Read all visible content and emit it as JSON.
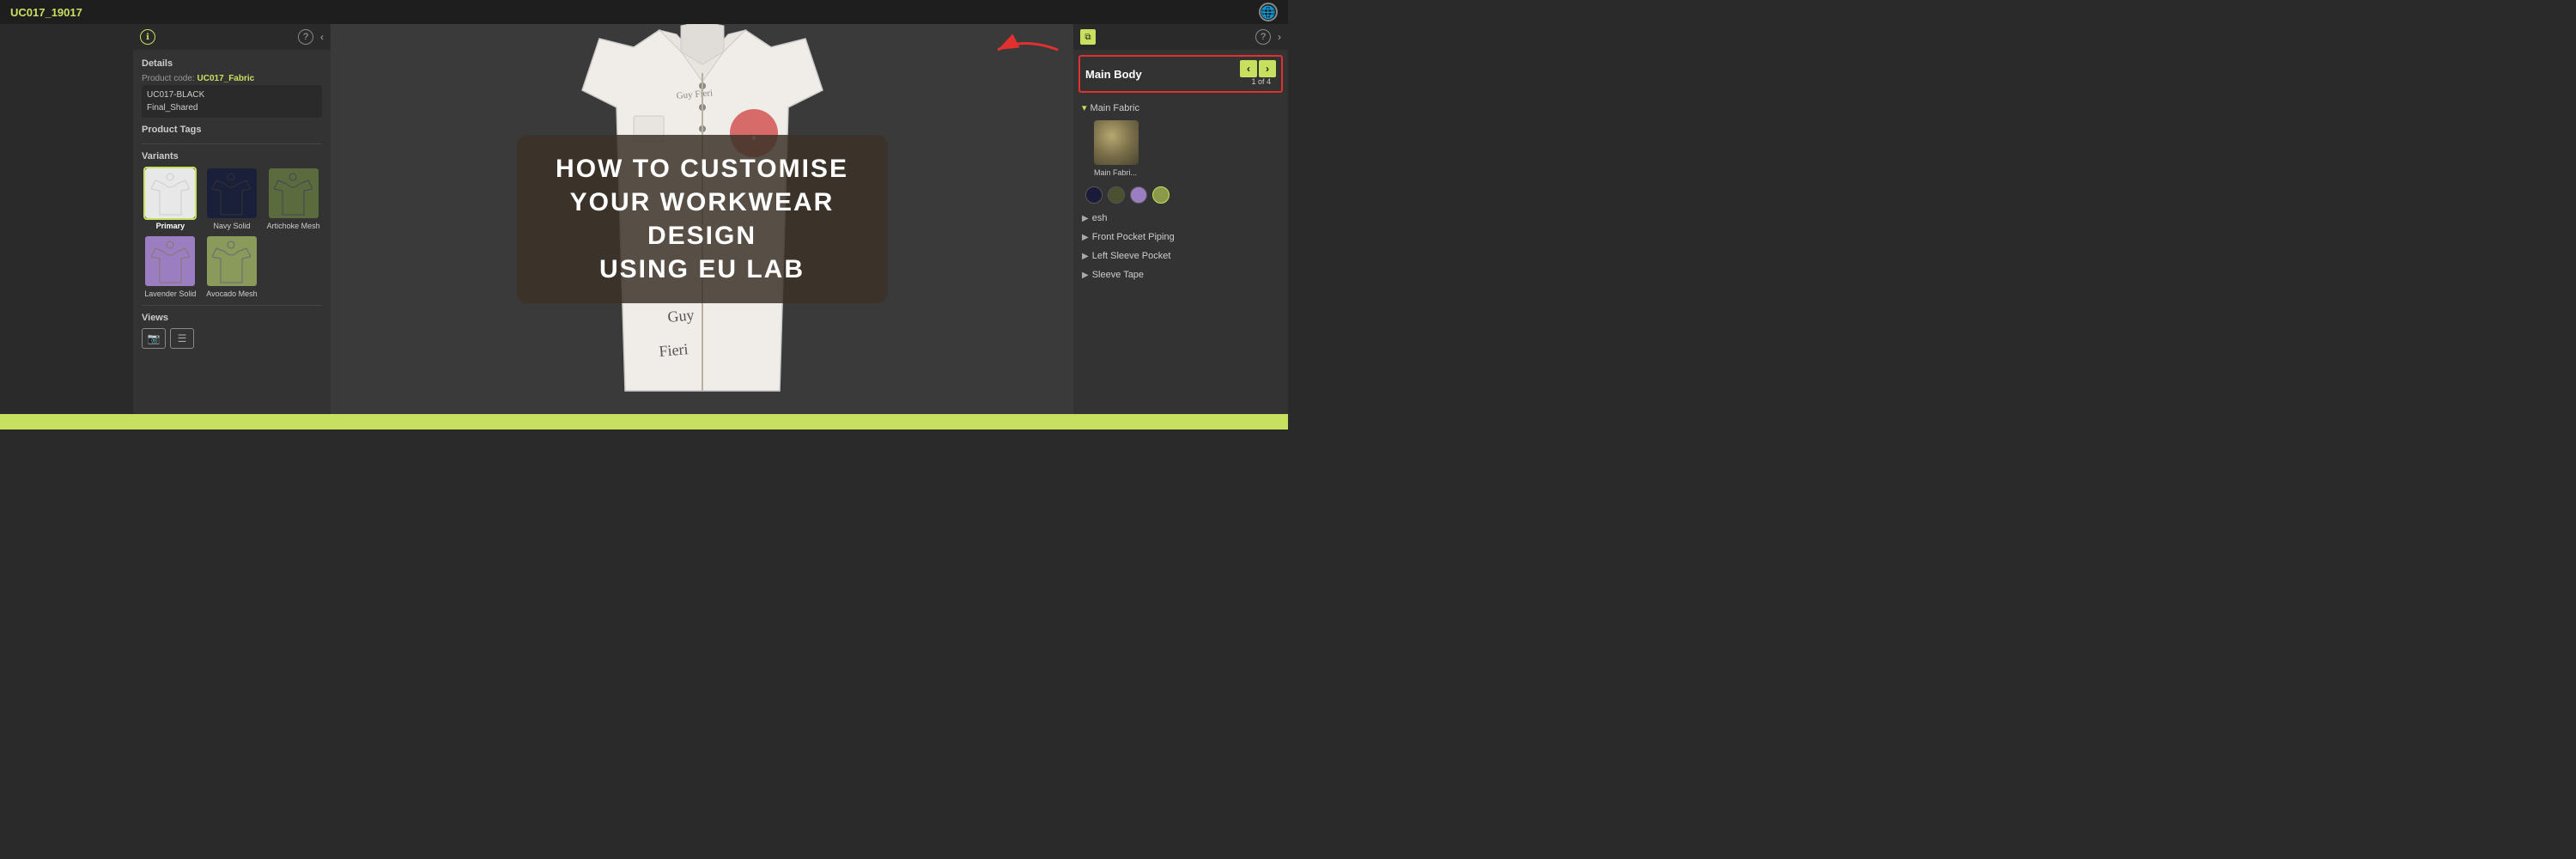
{
  "topbar": {
    "product_id": "UC017_19017",
    "globe_icon": "🌐"
  },
  "left_panel": {
    "details_label": "Details",
    "product_code_label": "Product code:",
    "product_code_value": "UC017_Fabric",
    "variant_names": [
      "UC017-BLACK",
      "Final_Shared"
    ],
    "product_tags_label": "Product Tags",
    "variants_label": "Variants",
    "variants": [
      {
        "name": "Primary",
        "color": "white",
        "selected": true
      },
      {
        "name": "Navy Solid",
        "color": "navy",
        "selected": false
      },
      {
        "name": "Artichoke Mesh",
        "color": "artichoke",
        "selected": false
      },
      {
        "name": "Lavender Solid",
        "color": "lavender",
        "selected": false
      },
      {
        "name": "Avocado Mesh",
        "color": "avocado",
        "selected": false
      }
    ],
    "views_label": "Views"
  },
  "right_panel": {
    "main_body_label": "Main Body",
    "counter": "1 of 4",
    "nav_prev": "‹",
    "nav_next": "›",
    "main_fabric_label": "Main Fabric",
    "fabric_name": "Main Fabri...",
    "expandable": [
      {
        "label": "Front Pocket Piping"
      },
      {
        "label": "Left Sleeve Pocket"
      },
      {
        "label": "Sleeve Tape"
      }
    ],
    "color_swatches": [
      {
        "color": "#1a1a3a"
      },
      {
        "color": "#4a4a30"
      },
      {
        "color": "#9b7ec1"
      },
      {
        "color": "#8a9a4a"
      }
    ]
  },
  "overlay": {
    "line1": "HOW TO CUSTOMISE",
    "line2": "YOUR WORKWEAR DESIGN",
    "line3": "USING EU LAB"
  }
}
